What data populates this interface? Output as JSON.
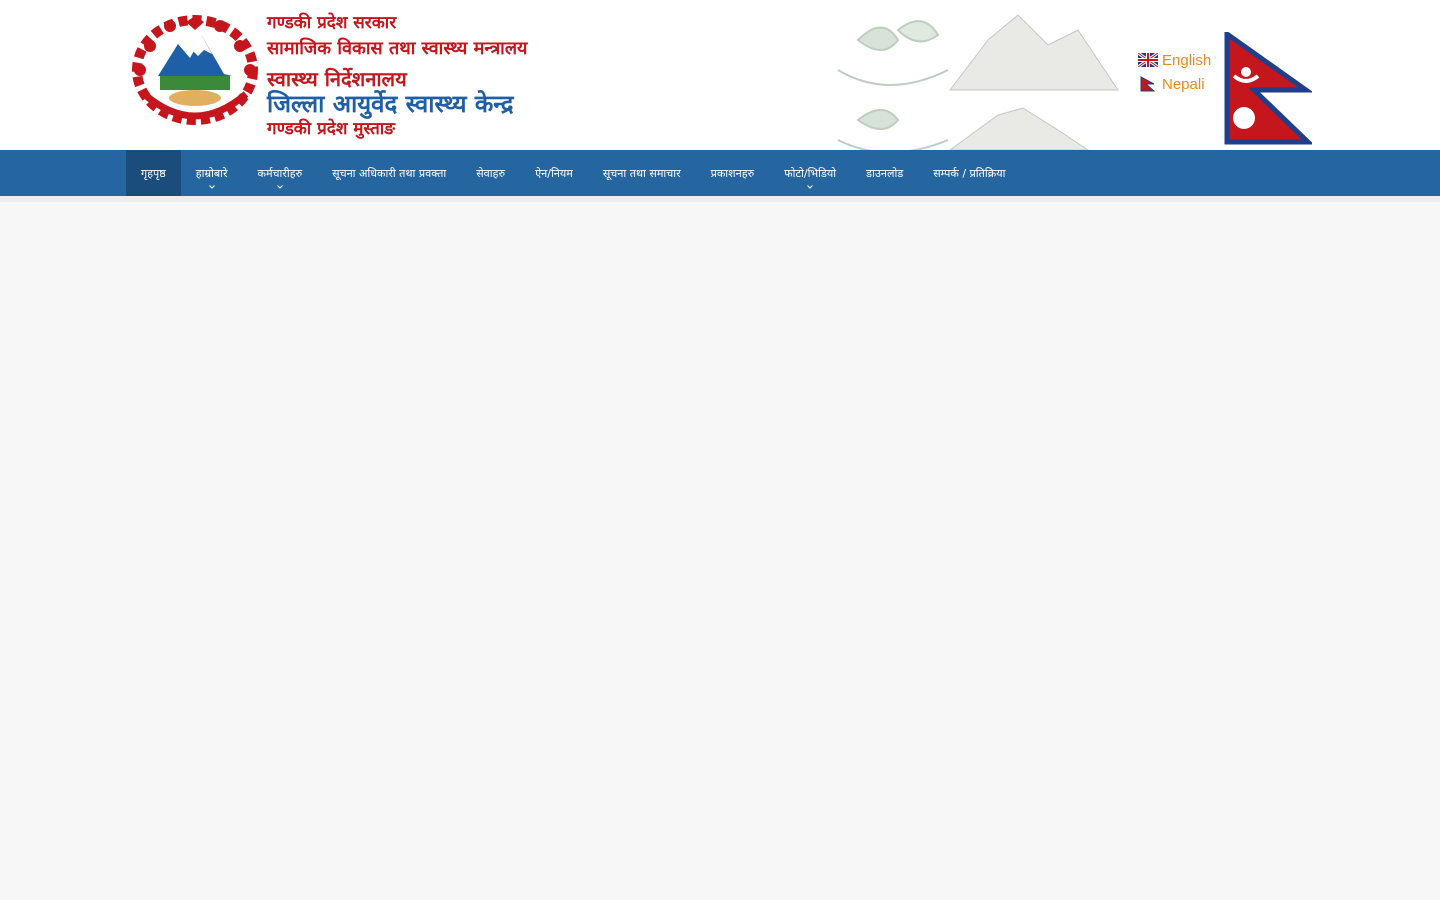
{
  "header": {
    "org_lines": [
      "गण्डकी प्रदेश सरकार",
      "सामाजिक विकास तथा स्वास्थ्य मन्त्रालय",
      "स्वास्थ्य निर्देशनालय",
      "जिल्ला आयुर्वेद स्वास्थ्य केन्द्र",
      "गण्डकी प्रदेश मुस्ताङ"
    ],
    "emblem_icon": "nepal-emblem-icon",
    "flag_icon": "nepal-flag-icon"
  },
  "language": {
    "english": "English",
    "nepali": "Nepali"
  },
  "colors": {
    "nav_bg": "#2565a0",
    "nav_active": "#1a4c7c",
    "title_red": "#c4161c",
    "title_blue": "#1f5fa8",
    "lang_link": "#e48b1a"
  },
  "nav": {
    "items": [
      {
        "label": "गृहपृष्ठ",
        "dropdown": false,
        "active": true
      },
      {
        "label": "हाम्रोबारे",
        "dropdown": true
      },
      {
        "label": "कर्मचारीहरु",
        "dropdown": true
      },
      {
        "label": "सूचना अधिकारी तथा प्रवक्ता",
        "dropdown": false
      },
      {
        "label": "सेवाहरु",
        "dropdown": false
      },
      {
        "label": "ऐन/नियम",
        "dropdown": false
      },
      {
        "label": "सूचना तथा समाचार",
        "dropdown": false
      },
      {
        "label": "प्रकाशनहरु",
        "dropdown": false
      },
      {
        "label": "फोटो/भिडियो",
        "dropdown": true
      },
      {
        "label": "डाउनलोड",
        "dropdown": false
      },
      {
        "label": "सम्पर्क / प्रतिक्रिया",
        "dropdown": false
      }
    ]
  }
}
